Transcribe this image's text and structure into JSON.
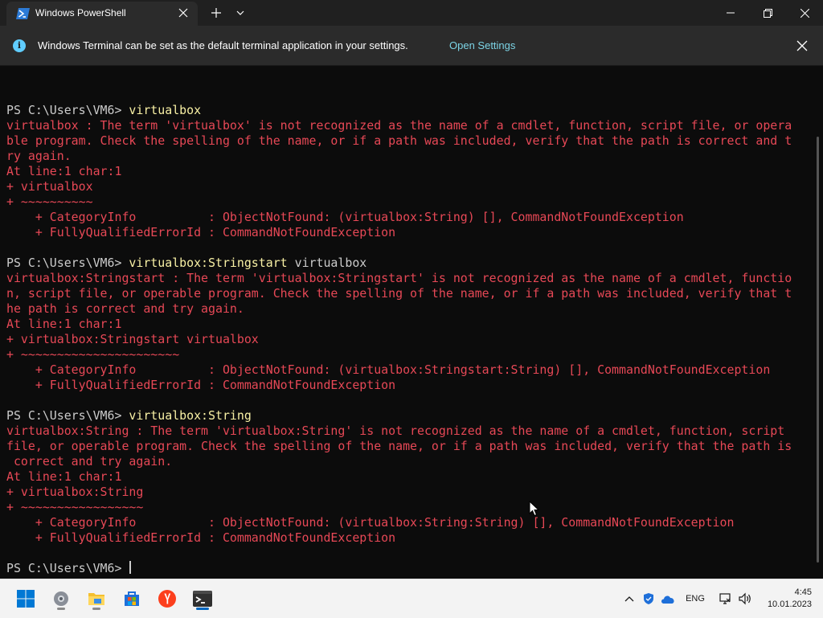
{
  "window": {
    "tab_title": "Windows PowerShell"
  },
  "infobar": {
    "message": "Windows Terminal can be set as the default terminal application in your settings.",
    "link": "Open Settings"
  },
  "terminal": {
    "lines": [
      {
        "text": ""
      },
      {
        "prompt": "PS C:\\Users\\VM6> ",
        "cmd": "virtualbox"
      },
      {
        "err": "virtualbox : The term 'virtualbox' is not recognized as the name of a cmdlet, function, script file, or opera"
      },
      {
        "err": "ble program. Check the spelling of the name, or if a path was included, verify that the path is correct and t"
      },
      {
        "err": "ry again."
      },
      {
        "err": "At line:1 char:1"
      },
      {
        "err": "+ virtualbox"
      },
      {
        "err": "+ ~~~~~~~~~~"
      },
      {
        "err": "    + CategoryInfo          : ObjectNotFound: (virtualbox:String) [], CommandNotFoundException"
      },
      {
        "err": "    + FullyQualifiedErrorId : CommandNotFoundException"
      },
      {
        "text": ""
      },
      {
        "prompt": "PS C:\\Users\\VM6> ",
        "cmd": "virtualbox:Stringstart",
        "cmd2": " virtualbox"
      },
      {
        "err": "virtualbox:Stringstart : The term 'virtualbox:Stringstart' is not recognized as the name of a cmdlet, functio"
      },
      {
        "err": "n, script file, or operable program. Check the spelling of the name, or if a path was included, verify that t"
      },
      {
        "err": "he path is correct and try again."
      },
      {
        "err": "At line:1 char:1"
      },
      {
        "err": "+ virtualbox:Stringstart virtualbox"
      },
      {
        "err": "+ ~~~~~~~~~~~~~~~~~~~~~~"
      },
      {
        "err": "    + CategoryInfo          : ObjectNotFound: (virtualbox:Stringstart:String) [], CommandNotFoundException"
      },
      {
        "err": "    + FullyQualifiedErrorId : CommandNotFoundException"
      },
      {
        "text": ""
      },
      {
        "prompt": "PS C:\\Users\\VM6> ",
        "cmd": "virtualbox:String"
      },
      {
        "err": "virtualbox:String : The term 'virtualbox:String' is not recognized as the name of a cmdlet, function, script"
      },
      {
        "err": "file, or operable program. Check the spelling of the name, or if a path was included, verify that the path is"
      },
      {
        "err": " correct and try again."
      },
      {
        "err": "At line:1 char:1"
      },
      {
        "err": "+ virtualbox:String"
      },
      {
        "err": "+ ~~~~~~~~~~~~~~~~~"
      },
      {
        "err": "    + CategoryInfo          : ObjectNotFound: (virtualbox:String:String) [], CommandNotFoundException"
      },
      {
        "err": "    + FullyQualifiedErrorId : CommandNotFoundException"
      },
      {
        "text": ""
      },
      {
        "prompt": "PS C:\\Users\\VM6> ",
        "cursor": true
      }
    ]
  },
  "taskbar": {
    "tray": {
      "language": "ENG"
    },
    "clock": {
      "time": "4:45",
      "date": "10.01.2023"
    }
  },
  "colors": {
    "error": "#e74856",
    "command": "#f9f1a5",
    "prompt": "#cccccc",
    "background": "#0c0c0c",
    "link": "#7cd4e6"
  }
}
